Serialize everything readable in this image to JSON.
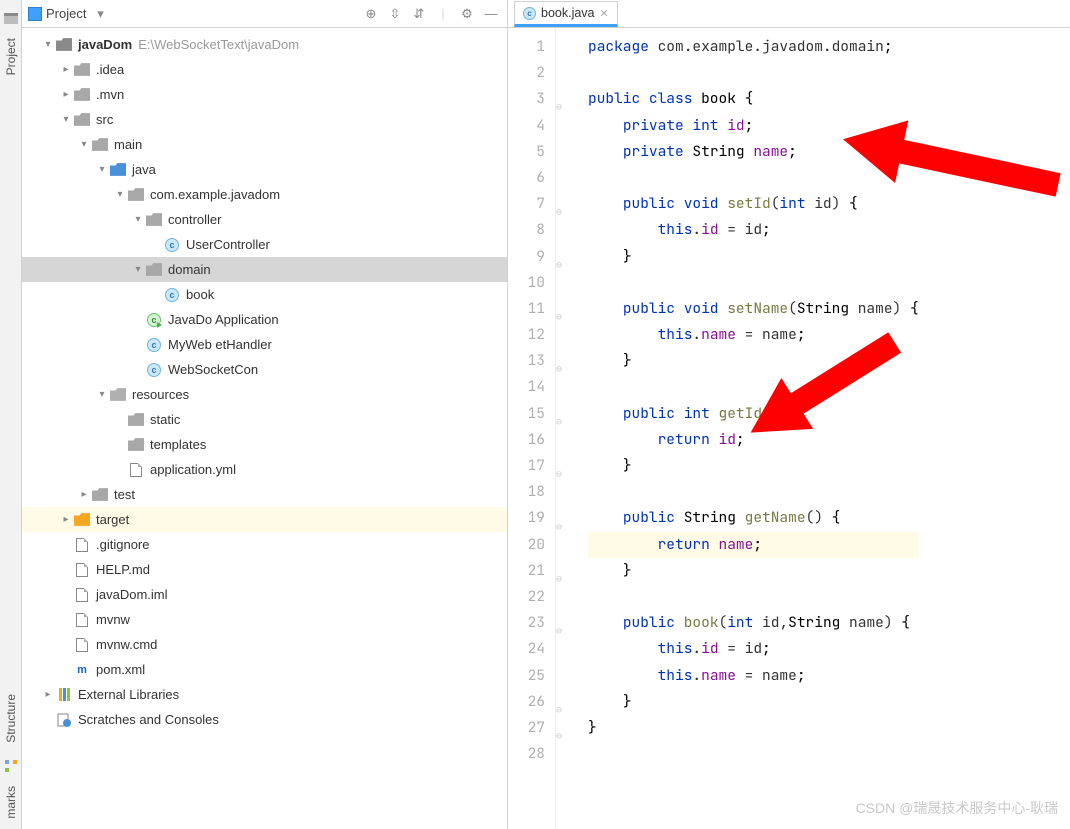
{
  "sideTabs": {
    "project": "Project",
    "structure": "Structure",
    "bookmarks": "marks"
  },
  "toolbar": {
    "projectLabel": "Project"
  },
  "editorTab": {
    "filename": "book.java"
  },
  "tree": {
    "root": {
      "name": "javaDom",
      "path": "E:\\WebSocketText\\javaDom"
    },
    "idea": ".idea",
    "mvn": ".mvn",
    "src": "src",
    "main": "main",
    "java": "java",
    "pkg": "com.example.javadom",
    "controller": "controller",
    "userController": "UserController",
    "domain": "domain",
    "book": "book",
    "app": "JavaDo      Application",
    "handler": "MyWeb        etHandler",
    "wsconfig": "WebSocketCon",
    "resources": "resources",
    "static": "static",
    "templates": "templates",
    "appyml": "application.yml",
    "test": "test",
    "target": "target",
    "gitignore": ".gitignore",
    "help": "HELP.md",
    "iml": "javaDom.iml",
    "mvnw": "mvnw",
    "mvnwcmd": "mvnw.cmd",
    "pom": "pom.xml",
    "extlibs": "External Libraries",
    "scratches": "Scratches and Consoles"
  },
  "code": [
    {
      "n": 1,
      "html": "<span class='k'>package</span> com.example.javadom.domain<span class='sc'>;</span>"
    },
    {
      "n": 2,
      "html": ""
    },
    {
      "n": 3,
      "html": "<span class='k'>public class</span> <span class='t'>book</span> <span class='sc'>{</span>"
    },
    {
      "n": 4,
      "html": "    <span class='k'>private int</span> <span class='f'>id</span><span class='sc'>;</span>"
    },
    {
      "n": 5,
      "html": "    <span class='k'>private</span> <span class='t'>String</span> <span class='f'>name</span><span class='sc'>;</span>"
    },
    {
      "n": 6,
      "html": ""
    },
    {
      "n": 7,
      "html": "    <span class='k'>public void</span> <span class='m'>setId</span>(<span class='k'>int</span> id) <span class='sc'>{</span>"
    },
    {
      "n": 8,
      "html": "        <span class='k'>this</span>.<span class='f'>id</span> = id<span class='sc'>;</span>"
    },
    {
      "n": 9,
      "html": "    <span class='sc'>}</span>"
    },
    {
      "n": 10,
      "html": ""
    },
    {
      "n": 11,
      "html": "    <span class='k'>public void</span> <span class='m'>setName</span>(<span class='t'>String</span> name) <span class='sc'>{</span>"
    },
    {
      "n": 12,
      "html": "        <span class='k'>this</span>.<span class='f'>name</span> = name<span class='sc'>;</span>"
    },
    {
      "n": 13,
      "html": "    <span class='sc'>}</span>"
    },
    {
      "n": 14,
      "html": ""
    },
    {
      "n": 15,
      "html": "    <span class='k'>public int</span> <span class='m'>getId</span>() <span class='sc'>{</span>"
    },
    {
      "n": 16,
      "html": "        <span class='k'>return</span> <span class='f'>id</span><span class='sc'>;</span>"
    },
    {
      "n": 17,
      "html": "    <span class='sc'>}</span>"
    },
    {
      "n": 18,
      "html": ""
    },
    {
      "n": 19,
      "html": "    <span class='k'>public</span> <span class='t'>String</span> <span class='m'>getName</span>() <span class='sc'>{</span>"
    },
    {
      "n": 20,
      "html": "        <span class='k'>return</span> <span class='f'>name</span><span class='sc'>;</span>",
      "hl": true
    },
    {
      "n": 21,
      "html": "    <span class='sc'>}</span>"
    },
    {
      "n": 22,
      "html": ""
    },
    {
      "n": 23,
      "html": "    <span class='k'>public</span> <span class='m'>book</span>(<span class='k'>int</span> id,<span class='t'>String</span> name) <span class='sc'>{</span>"
    },
    {
      "n": 24,
      "html": "        <span class='k'>this</span>.<span class='f'>id</span> = id<span class='sc'>;</span>"
    },
    {
      "n": 25,
      "html": "        <span class='k'>this</span>.<span class='f'>name</span> = name<span class='sc'>;</span>"
    },
    {
      "n": 26,
      "html": "    <span class='sc'>}</span>"
    },
    {
      "n": 27,
      "html": "<span class='sc'>}</span>"
    },
    {
      "n": 28,
      "html": ""
    }
  ],
  "watermark": "CSDN @瑞晟技术服务中心-耿瑞"
}
